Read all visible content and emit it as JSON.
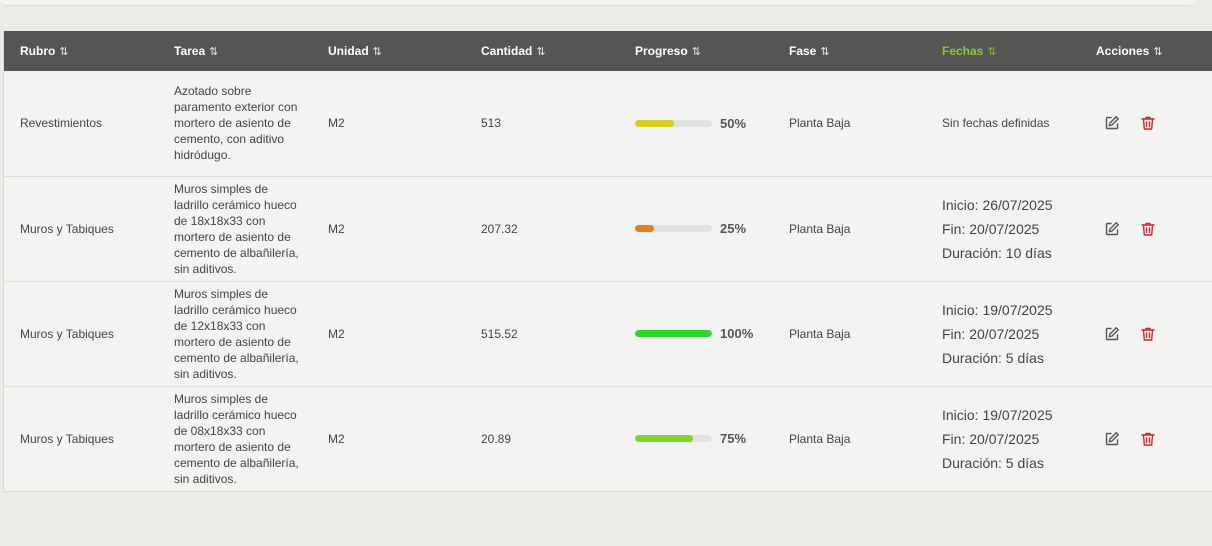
{
  "header": {
    "columns": [
      {
        "label": "Rubro",
        "sort": "⇅"
      },
      {
        "label": "Tarea",
        "sort": "⇅"
      },
      {
        "label": "Unidad",
        "sort": "⇅"
      },
      {
        "label": "Cantidad",
        "sort": "⇅"
      },
      {
        "label": "Progreso",
        "sort": "⇅"
      },
      {
        "label": "Fase",
        "sort": "⇅"
      },
      {
        "label": "Fechas",
        "sort": "⇅"
      },
      {
        "label": "Acciones",
        "sort": "⇅"
      }
    ]
  },
  "colors": {
    "header_bg": "#555553",
    "active_header": "#8bc53f",
    "delete_icon": "#d0262f",
    "edit_icon": "#555555"
  },
  "rows": [
    {
      "rubro": "Revestimientos",
      "tarea": "Azotado sobre paramento exterior con mortero de asiento de cemento, con aditivo hidródugo.",
      "unidad": "M2",
      "cantidad": "513",
      "progreso": 50,
      "progreso_label": "50%",
      "progreso_color": "#d6cf1f",
      "fase": "Planta Baja",
      "fechas": {
        "sin_fechas": "Sin fechas definidas"
      }
    },
    {
      "rubro": "Muros y Tabiques",
      "tarea": "Muros simples de ladrillo cerámico hueco de 18x18x33 con mortero de asiento de cemento de albañilería, sin aditivos.",
      "unidad": "M2",
      "cantidad": "207.32",
      "progreso": 25,
      "progreso_label": "25%",
      "progreso_color": "#e07f27",
      "fase": "Planta Baja",
      "fechas": {
        "inicio": "Inicio: 26/07/2025",
        "fin": "Fin: 20/07/2025",
        "duracion": "Duración: 10 días"
      }
    },
    {
      "rubro": "Muros y Tabiques",
      "tarea": "Muros simples de ladrillo cerámico hueco de 12x18x33 con mortero de asiento de cemento de albañilería, sin aditivos.",
      "unidad": "M2",
      "cantidad": "515.52",
      "progreso": 100,
      "progreso_label": "100%",
      "progreso_color": "#2bd62b",
      "fase": "Planta Baja",
      "fechas": {
        "inicio": "Inicio: 19/07/2025",
        "fin": "Fin: 20/07/2025",
        "duracion": "Duración: 5 días"
      }
    },
    {
      "rubro": "Muros y Tabiques",
      "tarea": "Muros simples de ladrillo cerámico hueco de 08x18x33 con mortero de asiento de cemento de albañilería, sin aditivos.",
      "unidad": "M2",
      "cantidad": "20.89",
      "progreso": 75,
      "progreso_label": "75%",
      "progreso_color": "#7bd630",
      "fase": "Planta Baja",
      "fechas": {
        "inicio": "Inicio: 19/07/2025",
        "fin": "Fin: 20/07/2025",
        "duracion": "Duración: 5 días"
      }
    }
  ]
}
